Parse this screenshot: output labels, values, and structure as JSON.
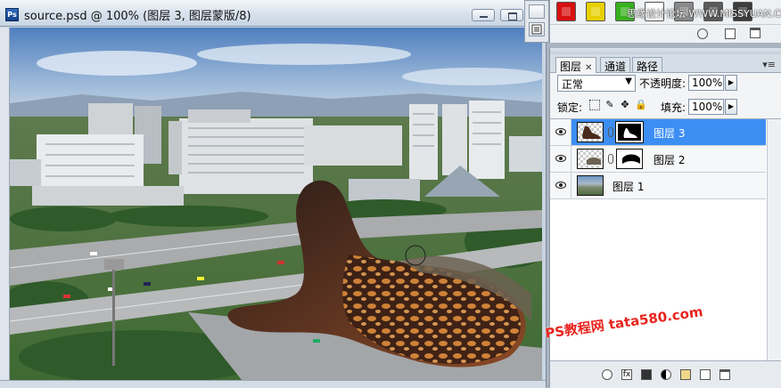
{
  "document": {
    "app_icon_label": "Ps",
    "title": "source.psd @ 100% (图层 3, 图层蒙版/8)",
    "statusbar_text": ""
  },
  "styles_panel": {
    "swatches": [
      "#d81010",
      "#e7d000",
      "#37b21d",
      "#ffffff",
      "#8a8a8a",
      "#5b5b5b",
      "#3c3c3c"
    ]
  },
  "watermarks": {
    "top": "思缘设计论坛 WWW.MISSYUAN.COM",
    "bottom": "PS教程网 tata580.com"
  },
  "layers_panel": {
    "tabs": [
      {
        "label": "图层",
        "active": true
      },
      {
        "label": "通道",
        "active": false
      },
      {
        "label": "路径",
        "active": false
      }
    ],
    "blend_mode": "正常",
    "opacity_label": "不透明度:",
    "opacity_value": "100%",
    "lock_label": "锁定:",
    "fill_label": "填充:",
    "fill_value": "100%",
    "layers": [
      {
        "name": "图层 3",
        "selected": true,
        "has_mask": true
      },
      {
        "name": "图层 2",
        "selected": false,
        "has_mask": true
      },
      {
        "name": "图层 1",
        "selected": false,
        "has_mask": false
      }
    ]
  }
}
